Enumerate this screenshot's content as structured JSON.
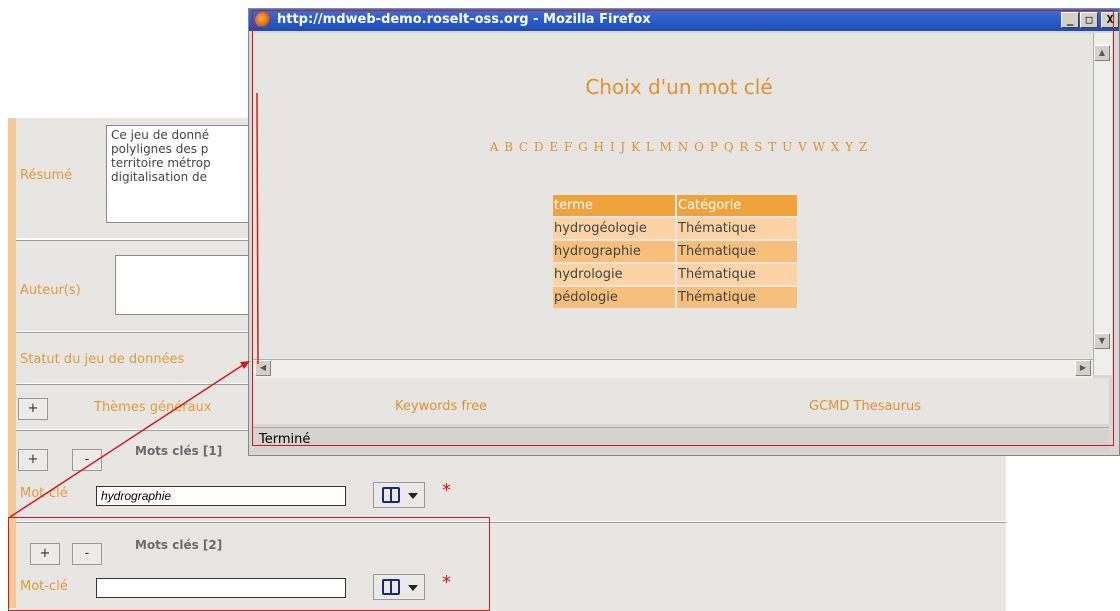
{
  "form": {
    "summary_label": "Résumé",
    "summary_text": [
      "Ce jeu de donné",
      "polylignes des p",
      "territoire métrop",
      "digitalisation de"
    ],
    "author_label": "Auteur(s)",
    "status_label": "Statut du jeu de données",
    "themes_plus": "+",
    "themes_label": "Thèmes généraux",
    "keywords_1_heading": "Mots clés [1]",
    "keywords_2_heading": "Mots clés [2]",
    "plus": "+",
    "minus": "-",
    "keyword_label": "Mot-clé",
    "keyword_1_value": "hydrographie",
    "keyword_2_value": "",
    "required_mark": "*"
  },
  "popup": {
    "window_title": "http://mdweb-demo.roselt-oss.org - Mozilla Firefox",
    "minimize": "_",
    "maximize": "□",
    "close": "X",
    "dialog_title": "Choix d'un mot clé",
    "alphabet": [
      "A",
      "B",
      "C",
      "D",
      "E",
      "F",
      "G",
      "H",
      "I",
      "J",
      "K",
      "L",
      "M",
      "N",
      "O",
      "P",
      "Q",
      "R",
      "S",
      "T",
      "U",
      "V",
      "W",
      "X",
      "Y",
      "Z"
    ],
    "table_headers": [
      "terme",
      "Catégorie"
    ],
    "table_rows": [
      [
        "hydrogéologie",
        "Thématique"
      ],
      [
        "hydrographie",
        "Thématique"
      ],
      [
        "hydrologie",
        "Thématique"
      ],
      [
        "pédologie",
        "Thématique"
      ]
    ],
    "footer_links": [
      "Keywords free",
      "GCMD Thesaurus"
    ],
    "status_text": "Terminé"
  },
  "colors": {
    "accent_orange": "#e0922e",
    "highlight_red": "#d21a1a",
    "titlebar_blue": "#1c4bb8"
  }
}
